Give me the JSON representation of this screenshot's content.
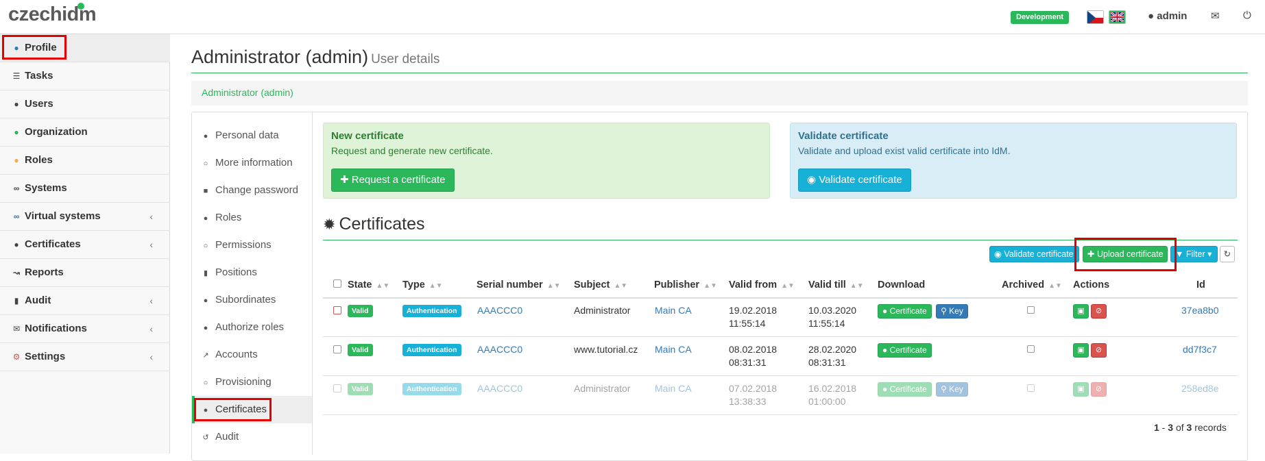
{
  "header": {
    "logo_text": "czechidm",
    "environment_badge": "Development",
    "user_name": "admin",
    "icons": [
      "cz-flag-icon",
      "en-flag-icon",
      "user-icon",
      "mail-icon",
      "power-icon"
    ]
  },
  "sidebar": {
    "items": [
      {
        "label": "Profile",
        "icon": "user-icon",
        "active": true
      },
      {
        "label": "Tasks",
        "icon": "tasks-icon"
      },
      {
        "label": "Users",
        "icon": "users-icon"
      },
      {
        "label": "Organization",
        "icon": "tree-icon"
      },
      {
        "label": "Roles",
        "icon": "roles-icon"
      },
      {
        "label": "Systems",
        "icon": "link-icon"
      },
      {
        "label": "Virtual systems",
        "icon": "link-icon",
        "chevron": "‹"
      },
      {
        "label": "Certificates",
        "icon": "certificate-icon",
        "chevron": "‹"
      },
      {
        "label": "Reports",
        "icon": "chart-icon"
      },
      {
        "label": "Audit",
        "icon": "bar-chart-icon",
        "chevron": "‹"
      },
      {
        "label": "Notifications",
        "icon": "envelope-icon",
        "chevron": "‹"
      },
      {
        "label": "Settings",
        "icon": "cog-icon",
        "chevron": "‹"
      }
    ]
  },
  "page": {
    "title": "Administrator (admin)",
    "subtitle": "User details",
    "breadcrumb": "Administrator (admin)"
  },
  "subnav": {
    "items": [
      {
        "label": "Personal data",
        "icon": "user-icon"
      },
      {
        "label": "More information",
        "icon": "circle-icon"
      },
      {
        "label": "Change password",
        "icon": "lock-icon"
      },
      {
        "label": "Roles",
        "icon": "roles-icon"
      },
      {
        "label": "Permissions",
        "icon": "circle-icon"
      },
      {
        "label": "Positions",
        "icon": "building-icon"
      },
      {
        "label": "Subordinates",
        "icon": "users-icon"
      },
      {
        "label": "Authorize roles",
        "icon": "roles-icon"
      },
      {
        "label": "Accounts",
        "icon": "external-link-icon"
      },
      {
        "label": "Provisioning",
        "icon": "circle-icon"
      },
      {
        "label": "Certificates",
        "icon": "dot-icon",
        "active": true
      },
      {
        "label": "Audit",
        "icon": "history-icon"
      }
    ]
  },
  "new_certificate": {
    "title": "New certificate",
    "text": "Request and generate new certificate.",
    "button": "Request a certificate"
  },
  "validate_certificate": {
    "title": "Validate certificate",
    "text": "Validate and upload exist valid certificate into IdM.",
    "button": "Validate certificate"
  },
  "certificates": {
    "title": "Certificates",
    "toolbar": {
      "validate": "Validate certificate",
      "upload": "Upload certificate",
      "filter": "Filter"
    },
    "columns": [
      "State",
      "Type",
      "Serial number",
      "Subject",
      "Publisher",
      "Valid from",
      "Valid till",
      "Download",
      "Archived",
      "Actions",
      "Id"
    ],
    "rows": [
      {
        "state": "Valid",
        "type": "Authentication",
        "serial": "AAACCC0",
        "subject": "Administrator",
        "publisher": "Main CA",
        "valid_from_date": "19.02.2018",
        "valid_from_time": "11:55:14",
        "valid_till_date": "10.03.2020",
        "valid_till_time": "11:55:14",
        "download_cert": "Certificate",
        "download_key": "Key",
        "id": "37ea8b0"
      },
      {
        "state": "Valid",
        "type": "Authentication",
        "serial": "AAACCC0",
        "subject": "www.tutorial.cz",
        "publisher": "Main CA",
        "valid_from_date": "08.02.2018",
        "valid_from_time": "08:31:31",
        "valid_till_date": "28.02.2020",
        "valid_till_time": "08:31:31",
        "download_cert": "Certificate",
        "download_key": "",
        "id": "dd7f3c7"
      },
      {
        "state": "Valid",
        "type": "Authentication",
        "serial": "AAACCC0",
        "subject": "Administrator",
        "publisher": "Main CA",
        "valid_from_date": "07.02.2018",
        "valid_from_time": "13:38:33",
        "valid_till_date": "16.02.2018",
        "valid_till_time": "01:00:00",
        "download_cert": "Certificate",
        "download_key": "Key",
        "id": "258ed8e"
      }
    ],
    "records": {
      "from": "1",
      "to": "3",
      "of_word": "of",
      "total": "3",
      "suffix": "records"
    }
  }
}
